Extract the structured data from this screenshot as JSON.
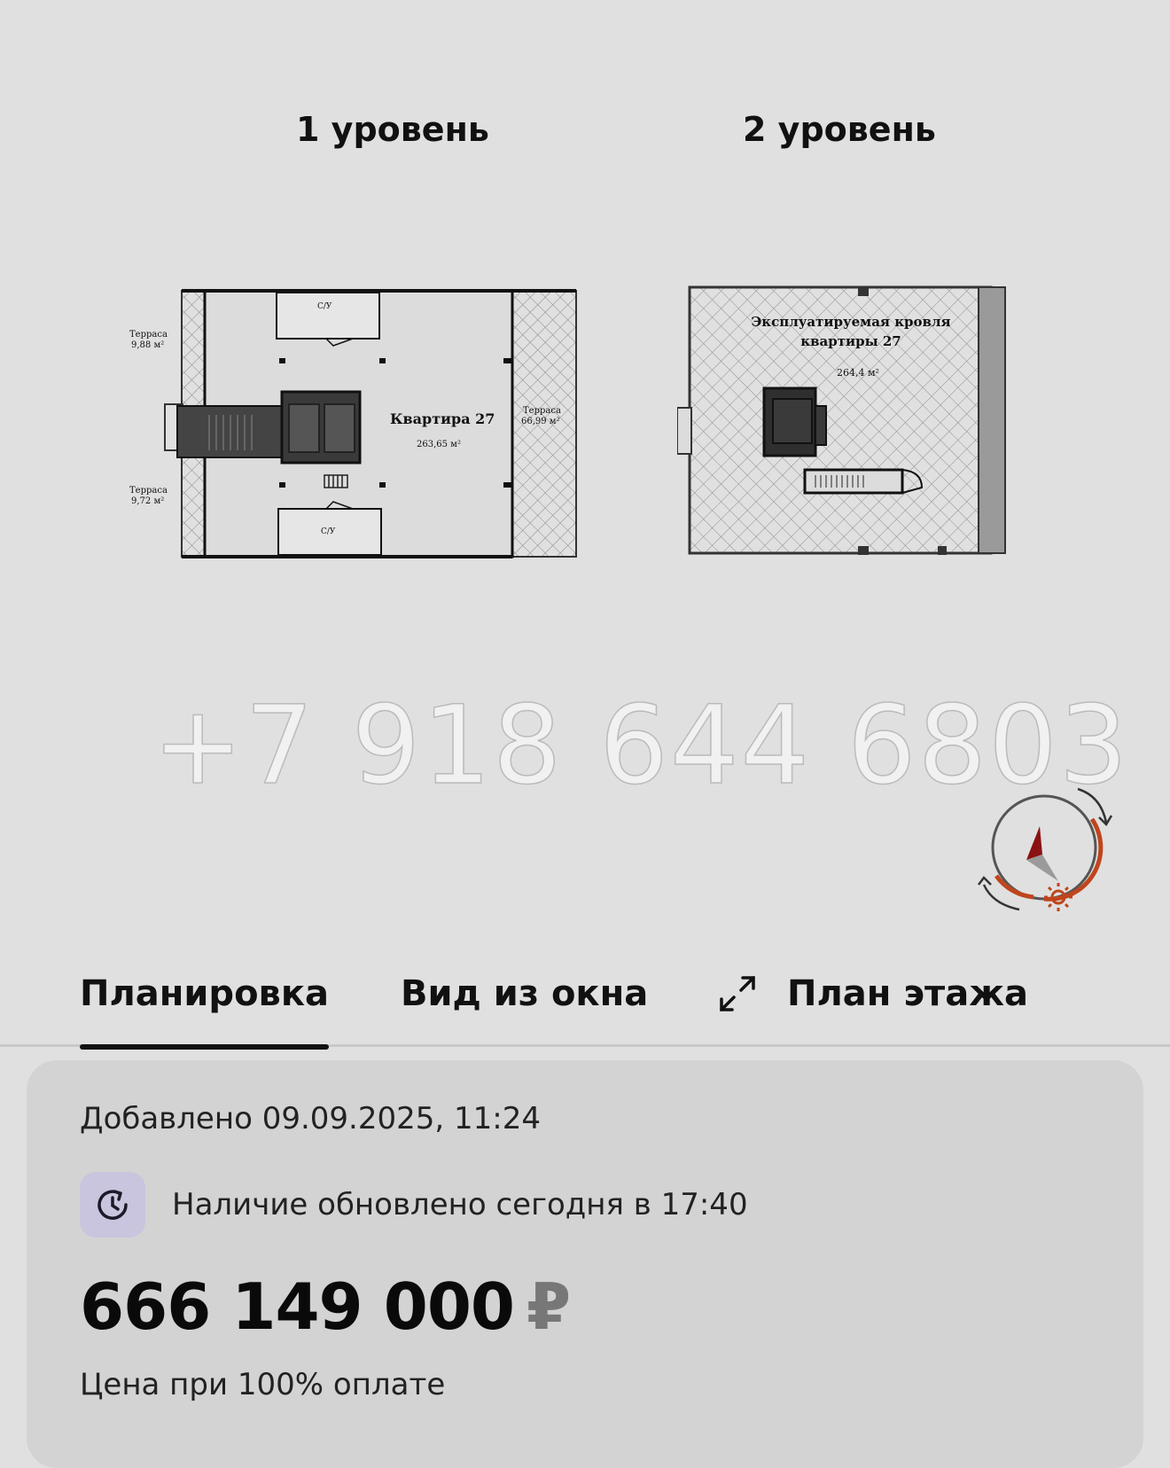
{
  "plans": {
    "level1": {
      "title": "1 уровень",
      "apartment_label": "Квартира 27",
      "apartment_area": "263,65 м²",
      "terrace_top_label": "Терраса",
      "terrace_top_area": "9,88 м²",
      "terrace_bottom_label": "Терраса",
      "terrace_bottom_area": "9,72 м²",
      "terrace_right_label": "Терраса",
      "terrace_right_area": "66,99 м²",
      "wc_top": "С/У",
      "wc_bottom": "С/У"
    },
    "level2": {
      "title": "2 уровень",
      "roof_label_line1": "Эксплуатируемая кровля",
      "roof_label_line2": "квартиры 27",
      "roof_area": "264,4 м²"
    }
  },
  "watermark": "+7 918 644 6803",
  "icons": {
    "compass": "compass-icon",
    "expand": "expand-arrows-icon",
    "clock": "clock-refresh-icon"
  },
  "tabs": [
    {
      "label": "Планировка",
      "active": true
    },
    {
      "label": "Вид из окна",
      "active": false
    },
    {
      "label": "План этажа",
      "active": false
    }
  ],
  "listing": {
    "added": "Добавлено 09.09.2025, 11:24",
    "stock_updated": "Наличие обновлено сегодня в 17:40",
    "price": "666 149 000",
    "currency": "₽",
    "price_note": "Цена при 100% оплате"
  },
  "colors": {
    "background": "#e0e0e0",
    "card": "#d3d3d3",
    "compass_accent": "#c0451c",
    "clock_badge": "#c9c5de"
  }
}
